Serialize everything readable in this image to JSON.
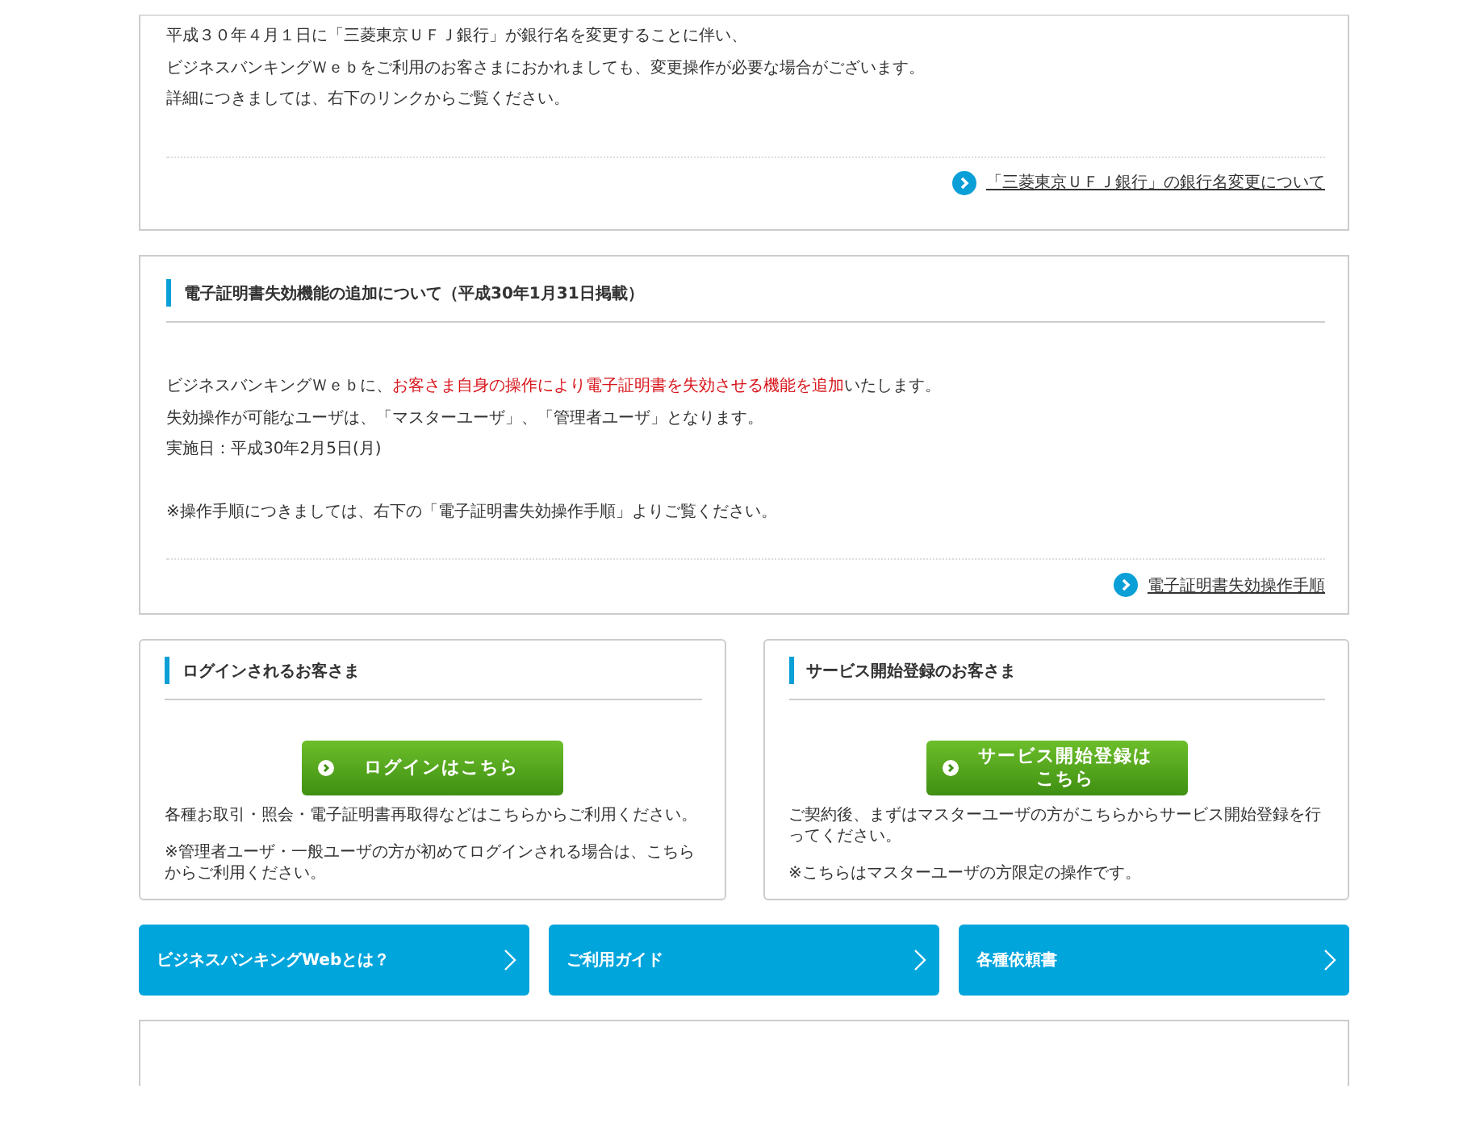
{
  "notices": [
    {
      "groups": [
        [
          [
            {
              "text": "平成３０年４月１日に「三菱東京ＵＦＪ銀行」が銀行名を変更することに伴い、",
              "highlight": false
            }
          ],
          [
            {
              "text": "ビジネスバンキングＷｅｂをご利用のお客さまにおかれましても、変更操作が必要な場合がございます。",
              "highlight": false
            }
          ],
          [
            {
              "text": "詳細につきましては、右下のリンクからご覧ください。",
              "highlight": false
            }
          ]
        ]
      ],
      "link": "「三菱東京ＵＦＪ銀行」の銀行名変更について"
    },
    {
      "title": "電子証明書失効機能の追加について（平成30年1月31日掲載）",
      "groups": [
        [
          [
            {
              "text": "ビジネスバンキングＷｅｂに、",
              "highlight": false
            },
            {
              "text": "お客さま自身の操作により電子証明書を失効させる機能を追加",
              "highlight": true
            },
            {
              "text": "いたします。",
              "highlight": false
            }
          ],
          [
            {
              "text": "失効操作が可能なユーザは、「マスターユーザ」、「管理者ユーザ」となります。",
              "highlight": false
            }
          ],
          [
            {
              "text": "実施日：平成30年2月5日(月)",
              "highlight": false
            }
          ]
        ],
        [
          [
            {
              "text": "※操作手順につきましては、右下の「電子証明書失効操作手順」よりご覧ください。",
              "highlight": false
            }
          ]
        ]
      ],
      "link": "電子証明書失効操作手順"
    }
  ],
  "panels": [
    {
      "title": "ログインされるお客さま",
      "button": "ログインはこちら",
      "notes": [
        "各種お取引・照会・電子証明書再取得などはこちらからご利用ください。",
        "※管理者ユーザ・一般ユーザの方が初めてログインされる場合は、こちらからご利用ください。"
      ]
    },
    {
      "title": "サービス開始登録のお客さま",
      "button": "サービス開始登録はこちら",
      "notes": [
        "ご契約後、まずはマスターユーザの方がこちらからサービス開始登録を行ってください。",
        "※こちらはマスターユーザの方限定の操作です。"
      ]
    }
  ],
  "nav_buttons": [
    "ビジネスバンキングWebとは？",
    "ご利用ガイド",
    "各種依頼書"
  ]
}
